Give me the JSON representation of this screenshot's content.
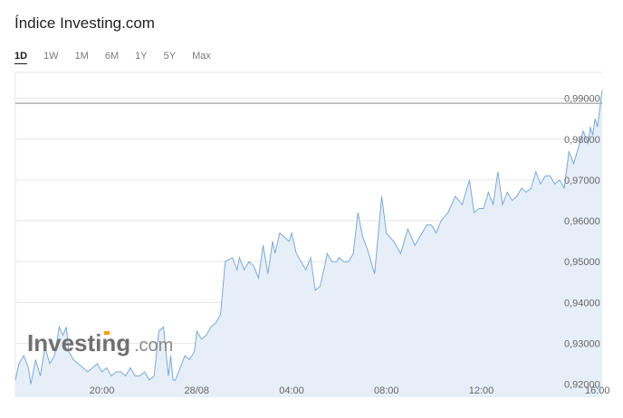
{
  "header": {
    "title": "Índice Investing.com"
  },
  "tabs": [
    {
      "label": "1D",
      "active": true
    },
    {
      "label": "1W",
      "active": false
    },
    {
      "label": "1M",
      "active": false
    },
    {
      "label": "6M",
      "active": false
    },
    {
      "label": "1Y",
      "active": false
    },
    {
      "label": "5Y",
      "active": false
    },
    {
      "label": "Max",
      "active": false
    }
  ],
  "watermark": {
    "brand": "Investing",
    "suffix": ".com"
  },
  "colors": {
    "line": "#7ea9d6",
    "area": "#e6eef7",
    "grid": "#e6e6e6",
    "ref": "#8c8c8c",
    "accent": "#f5a100"
  },
  "chart_data": {
    "type": "area",
    "x_tick_labels": [
      "20:00",
      "28/08",
      "04:00",
      "08:00",
      "12:00",
      "16:00"
    ],
    "x_tick_positions": [
      3,
      7,
      11,
      15,
      19,
      23.9
    ],
    "x_range": [
      -0.65,
      24.1
    ],
    "y_tick_labels": [
      "0,92000",
      "0,93000",
      "0,94000",
      "0,95000",
      "0,96000",
      "0,97000",
      "0,98000",
      "0,99000"
    ],
    "y_ticks": [
      0.92,
      0.93,
      0.94,
      0.95,
      0.96,
      0.97,
      0.98,
      0.99
    ],
    "ylim": [
      0.9168,
      0.9968
    ],
    "reference_value": 0.9888,
    "x": [
      -0.65,
      -0.5,
      -0.3,
      -0.1,
      0,
      0.2,
      0.4,
      0.6,
      0.8,
      1,
      1.2,
      1.35,
      1.5,
      1.6,
      1.8,
      2,
      2.2,
      2.4,
      2.6,
      2.8,
      3,
      3.2,
      3.4,
      3.6,
      3.8,
      4,
      4.2,
      4.4,
      4.6,
      4.8,
      5,
      5.2,
      5.4,
      5.6,
      5.8,
      5.9,
      6,
      6.1,
      6.3,
      6.5,
      6.7,
      6.9,
      7,
      7.2,
      7.4,
      7.6,
      7.8,
      8,
      8.2,
      8.5,
      8.7,
      8.8,
      9,
      9.2,
      9.4,
      9.6,
      9.8,
      10,
      10.2,
      10.3,
      10.5,
      10.7,
      10.9,
      11,
      11.2,
      11.4,
      11.6,
      11.8,
      12,
      12.2,
      12.4,
      12.5,
      12.7,
      12.9,
      13,
      13.2,
      13.4,
      13.6,
      13.8,
      14,
      14.2,
      14.5,
      14.8,
      15,
      15.3,
      15.6,
      15.9,
      16.2,
      16.5,
      16.7,
      16.9,
      17.1,
      17.3,
      17.6,
      17.9,
      18.2,
      18.5,
      18.7,
      18.9,
      19.1,
      19.3,
      19.5,
      19.7,
      19.9,
      20.1,
      20.3,
      20.5,
      20.7,
      20.9,
      21.1,
      21.3,
      21.5,
      21.7,
      21.9,
      22.1,
      22.3,
      22.5,
      22.7,
      22.9,
      23.1,
      23.3,
      23.5,
      23.6,
      23.7,
      23.8,
      23.9,
      24.1
    ],
    "values": [
      0.921,
      0.925,
      0.927,
      0.924,
      0.92,
      0.926,
      0.922,
      0.929,
      0.925,
      0.927,
      0.934,
      0.932,
      0.934,
      0.928,
      0.926,
      0.925,
      0.924,
      0.923,
      0.924,
      0.925,
      0.923,
      0.924,
      0.922,
      0.923,
      0.923,
      0.922,
      0.924,
      0.922,
      0.922,
      0.923,
      0.921,
      0.922,
      0.933,
      0.934,
      0.922,
      0.927,
      0.921,
      0.921,
      0.924,
      0.927,
      0.926,
      0.928,
      0.933,
      0.931,
      0.932,
      0.934,
      0.935,
      0.937,
      0.95,
      0.951,
      0.948,
      0.951,
      0.948,
      0.95,
      0.949,
      0.946,
      0.954,
      0.947,
      0.955,
      0.952,
      0.957,
      0.956,
      0.955,
      0.957,
      0.952,
      0.95,
      0.948,
      0.951,
      0.943,
      0.944,
      0.949,
      0.952,
      0.95,
      0.95,
      0.951,
      0.95,
      0.95,
      0.952,
      0.962,
      0.956,
      0.953,
      0.947,
      0.966,
      0.957,
      0.955,
      0.952,
      0.958,
      0.954,
      0.957,
      0.959,
      0.959,
      0.957,
      0.96,
      0.962,
      0.966,
      0.964,
      0.97,
      0.962,
      0.963,
      0.963,
      0.967,
      0.964,
      0.972,
      0.964,
      0.967,
      0.965,
      0.966,
      0.968,
      0.967,
      0.968,
      0.972,
      0.969,
      0.971,
      0.971,
      0.969,
      0.97,
      0.968,
      0.977,
      0.974,
      0.978,
      0.982,
      0.979,
      0.983,
      0.981,
      0.985,
      0.983,
      0.992,
      0.995,
      0.989,
      0.988,
      0.993
    ]
  }
}
